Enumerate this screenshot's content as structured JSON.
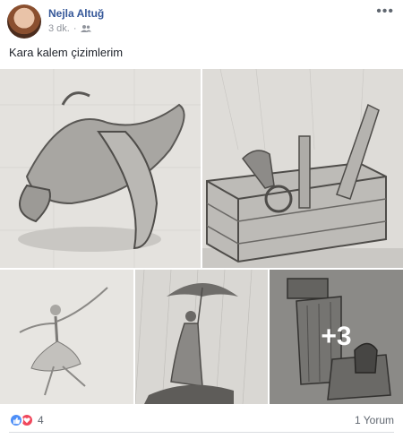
{
  "post": {
    "author": "Nejla Altuğ",
    "time": "3 dk.",
    "separator": "·",
    "privacy_icon": "friends-icon",
    "more_label": "•••",
    "caption": "Kara kalem çizimlerim"
  },
  "photos": {
    "items": [
      {
        "subject": "banana-sketch"
      },
      {
        "subject": "crate-with-tools-sketch"
      },
      {
        "subject": "ballerina-sketch"
      },
      {
        "subject": "woman-with-umbrella-sketch"
      },
      {
        "subject": "column-still-life-sketch"
      }
    ],
    "more_count": "+3"
  },
  "footer": {
    "reaction_icons": [
      "like-icon",
      "love-icon"
    ],
    "reaction_count": "4",
    "comments": "1 Yorum"
  },
  "colors": {
    "link": "#365899",
    "meta": "#90949c",
    "like": "#4d8ef7",
    "love": "#f0475c"
  }
}
